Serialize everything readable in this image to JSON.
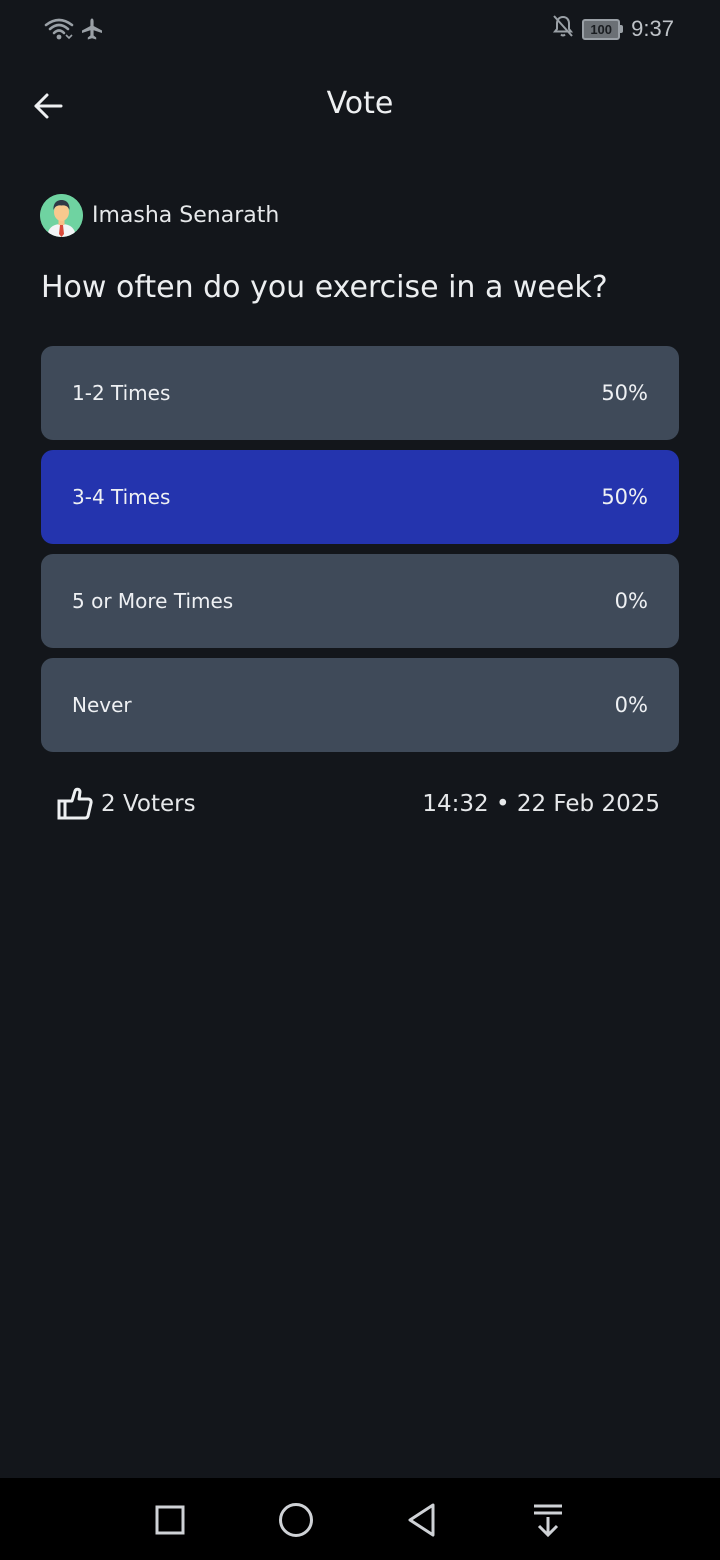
{
  "status_bar": {
    "time": "9:37",
    "battery_level": "100",
    "icons": [
      "wifi-icon",
      "airplane-icon",
      "notifications-off-icon",
      "battery-icon"
    ]
  },
  "app_bar": {
    "title": "Vote",
    "back_icon": "arrow-left-icon"
  },
  "poll": {
    "author_name": "Imasha Senarath",
    "question": "How often do you exercise in a week?",
    "options": [
      {
        "label": "1-2 Times",
        "percent": "50%",
        "selected": false
      },
      {
        "label": "3-4 Times",
        "percent": "50%",
        "selected": true
      },
      {
        "label": "5 or More Times",
        "percent": "0%",
        "selected": false
      },
      {
        "label": "Never",
        "percent": "0%",
        "selected": false
      }
    ],
    "voters": "2 Voters",
    "timestamp": "14:32 • 22 Feb 2025"
  },
  "colors": {
    "background": "#13161b",
    "option_bg": "#3f4a59",
    "selected_option_bg": "#2434ae"
  },
  "nav_bar": {
    "buttons": [
      "recent-apps-icon",
      "home-icon",
      "back-icon",
      "notification-pull-icon"
    ]
  }
}
